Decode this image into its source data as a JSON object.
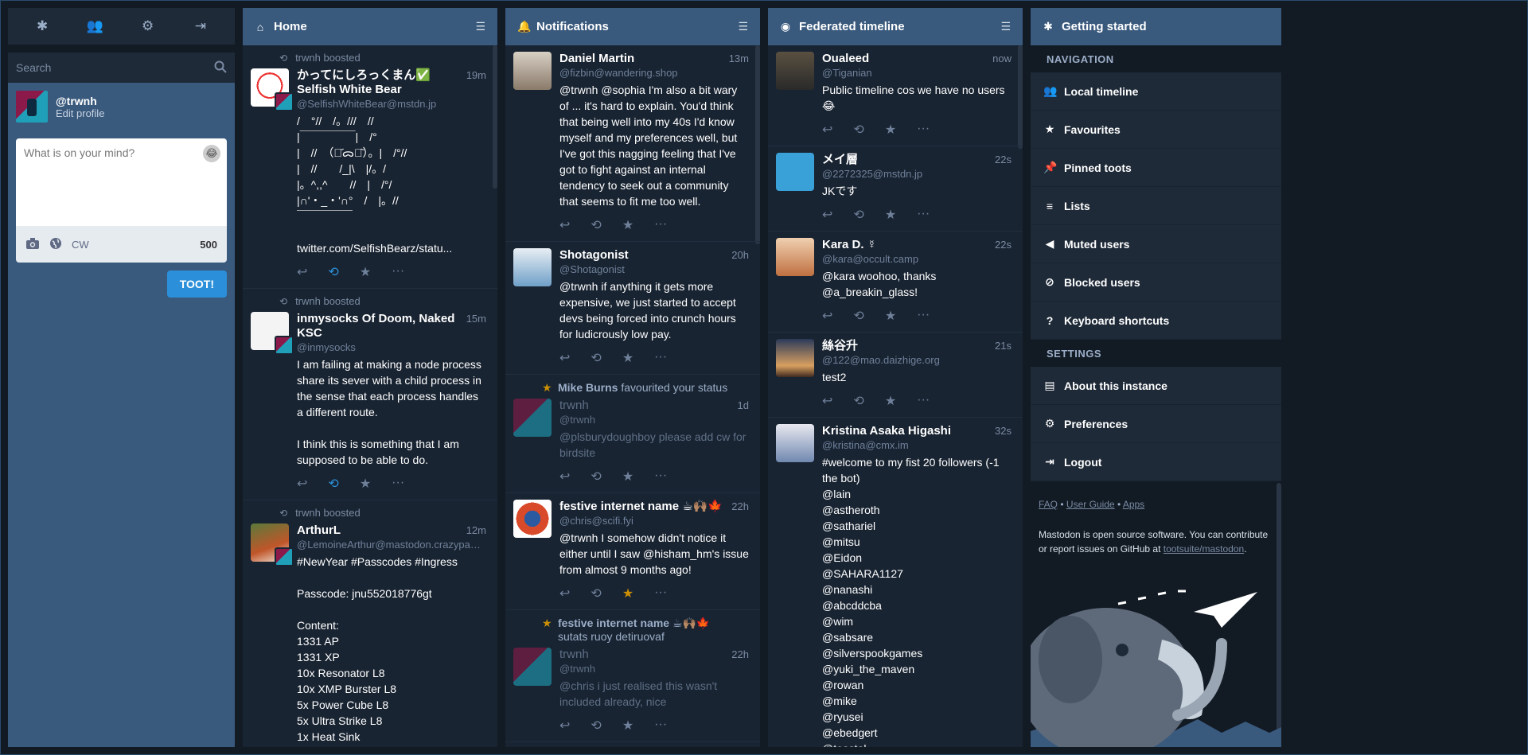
{
  "compose_nav": {
    "icons": [
      "asterisk-icon",
      "users-icon",
      "gear-icon",
      "sign-out-icon"
    ]
  },
  "search": {
    "placeholder": "Search"
  },
  "account": {
    "handle": "@trwnh",
    "edit": "Edit profile"
  },
  "compose": {
    "placeholder": "What is on your mind?",
    "cw_label": "CW",
    "char_count": "500",
    "toot_label": "TOOT!"
  },
  "home": {
    "title": "Home",
    "statuses": [
      {
        "boost": "trwnh boosted",
        "name": "かってにしろっくまん✅ Selfish White Bear",
        "acct": "@SelfishWhiteBear@mstdn.jp",
        "time": "19m",
        "text": "/　°//　/。///　//\n|￣￣￣￣￣|　/°\n|　//　（･᷄ᯅ･᷅）。|　/°//\n|　//　　/_|\\　|/。/\n|。^,,^　　//　|　/°/\n|∩'・_・'∩°　/　|。//\n￣￣￣￣￣\n\ntwitter.com/SelfishBearz/statu...",
        "boosted": true
      },
      {
        "boost": "trwnh boosted",
        "name": "inmysocks Of Doom, Naked KSC",
        "acct": "@inmysocks",
        "time": "15m",
        "text": "I am failing at making a node process share its sever with a child process in the sense that each process handles a different route.\n\nI think this is something that I am supposed to be able to do.",
        "boosted": true
      },
      {
        "boost": "trwnh boosted",
        "name": "ArthurL",
        "acct": "@LemoineArthur@mastodon.crazypanda.fr",
        "time": "12m",
        "text": "#NewYear #Passcodes #Ingress\n\nPasscode: jnu552018776gt\n\nContent:\n1331 AP\n1331 XP\n10x Resonator L8\n10x XMP Burster L8\n5x Power Cube L8\n5x Ultra Strike L8\n1x Heat Sink",
        "boosted": false
      }
    ]
  },
  "notifications": {
    "title": "Notifications",
    "items": [
      {
        "name": "Daniel Martin",
        "acct": "@fizbin@wandering.shop",
        "time": "13m",
        "text": "@trwnh @sophia I'm also a bit wary of ... it's hard to explain. You'd think that being well into my 40s I'd know myself and my preferences well, but I've got this nagging feeling that I've got to fight against an internal tendency to seek out a community that seems to fit me too well."
      },
      {
        "name": "Shotagonist",
        "acct": "@Shotagonist",
        "time": "20h",
        "text": "@trwnh if anything it gets more expensive, we just started to accept devs being forced into crunch hours for ludicrously low pay."
      },
      {
        "fav_who": "Mike Burns",
        "fav_label": "favourited your status",
        "name": "trwnh",
        "acct": "@trwnh",
        "time": "1d",
        "text": "@plsburydoughboy please add cw for birdsite"
      },
      {
        "name": "festive internet name ☕🙌🏽🍁",
        "acct": "@chris@scifi.fyi",
        "time": "22h",
        "text": "@trwnh I somehow didn't notice it either until I saw @hisham_hm's issue from almost 9 months ago!"
      },
      {
        "fav_who": "festive internet name ☕🙌🏽🍁",
        "fav_sub": "sutats ruoy detiruovaf",
        "name": "trwnh",
        "acct": "@trwnh",
        "time": "22h",
        "text": "@chris i just realised this wasn't included already, nice"
      }
    ]
  },
  "federated": {
    "title": "Federated timeline",
    "statuses": [
      {
        "name": "Oualeed",
        "acct": "@Tiganian",
        "time": "now",
        "text": "Public timeline cos we have no users 😂"
      },
      {
        "name": "メイ層",
        "acct": "@2272325@mstdn.jp",
        "time": "22s",
        "text": "JKです"
      },
      {
        "name": "Kara D. ☿",
        "acct": "@kara@occult.camp",
        "time": "22s",
        "text": "@kara woohoo, thanks @a_breakin_glass!"
      },
      {
        "name": "絲谷升",
        "acct": "@122@mao.daizhige.org",
        "time": "21s",
        "text": "test2"
      },
      {
        "name": "Kristina Asaka Higashi",
        "acct": "@kristina@cmx.im",
        "time": "32s",
        "text": "#welcome to my fist 20 followers (-1 the bot)\n@lain\n@astheroth\n@sathariel\n@mitsu\n@Eidon\n@SAHARA1127\n@nanashi\n@abcddcba\n@wim\n@sabsare\n@silverspookgames\n@yuki_the_maven\n@rowan\n@mike\n@ryusei\n@ebedgert\n@toastal"
      }
    ]
  },
  "getting_started": {
    "title": "Getting started",
    "nav_heading": "NAVIGATION",
    "nav": [
      {
        "label": "Local timeline",
        "icon": "users-icon"
      },
      {
        "label": "Favourites",
        "icon": "star-icon"
      },
      {
        "label": "Pinned toots",
        "icon": "thumbtack-icon"
      },
      {
        "label": "Lists",
        "icon": "bars-icon"
      },
      {
        "label": "Muted users",
        "icon": "volume-off-icon"
      },
      {
        "label": "Blocked users",
        "icon": "ban-icon"
      },
      {
        "label": "Keyboard shortcuts",
        "icon": "question-icon"
      }
    ],
    "settings_heading": "SETTINGS",
    "settings": [
      {
        "label": "About this instance",
        "icon": "book-icon"
      },
      {
        "label": "Preferences",
        "icon": "gear-icon"
      },
      {
        "label": "Logout",
        "icon": "sign-out-icon"
      }
    ],
    "footer_links": [
      "FAQ",
      "User Guide",
      "Apps"
    ],
    "footer_sep": "•",
    "footer_text": "Mastodon is open source software. You can contribute or report issues on GitHub at",
    "footer_repo": "tootsuite/mastodon",
    "footer_end": "."
  },
  "colors": {
    "accent": "#2b90d9",
    "header": "#39597d",
    "column_bg": "#192432",
    "favourite": "#ca8f04"
  }
}
